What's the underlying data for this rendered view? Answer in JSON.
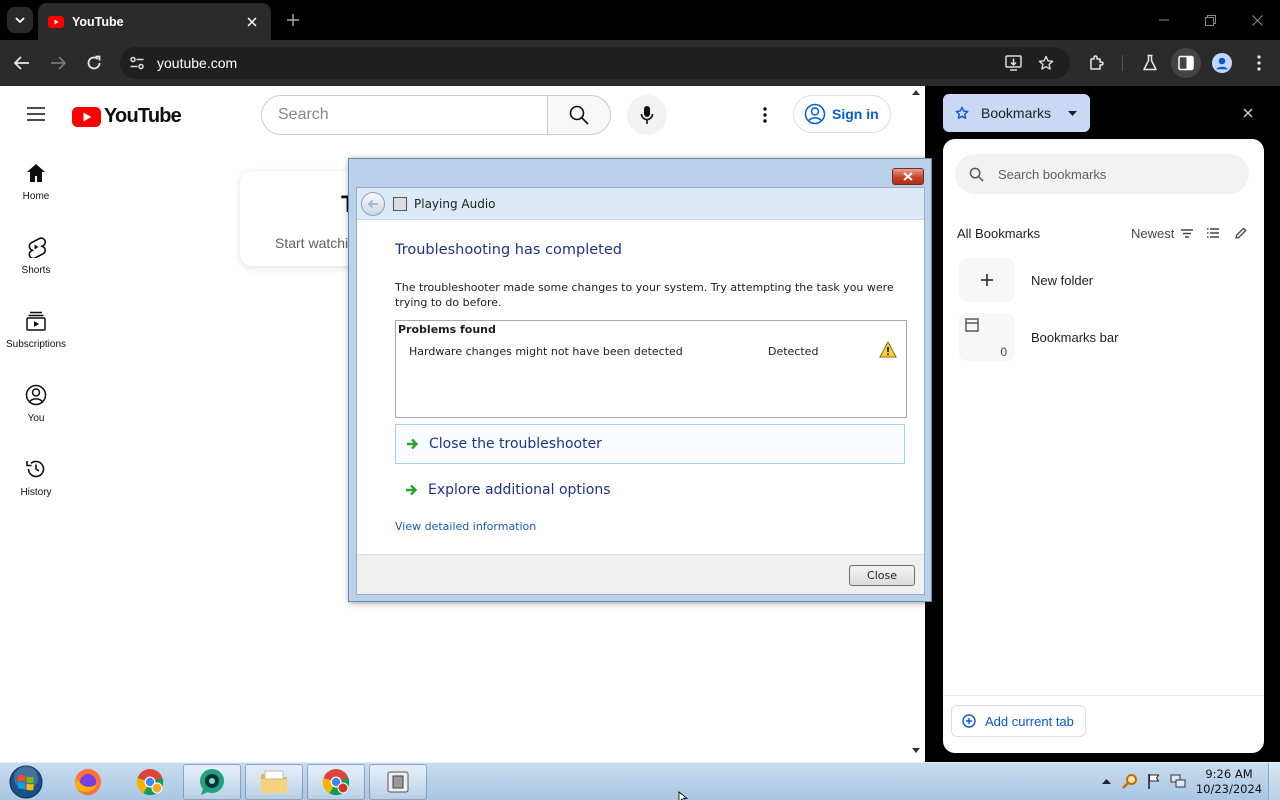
{
  "browser": {
    "tab_title": "YouTube",
    "url": "youtube.com"
  },
  "youtube": {
    "logo_text": "YouTube",
    "search_placeholder": "Search",
    "sign_in": "Sign in",
    "nav": [
      {
        "label": "Home"
      },
      {
        "label": "Shorts"
      },
      {
        "label": "Subscriptions"
      },
      {
        "label": "You"
      },
      {
        "label": "History"
      }
    ],
    "card_title": "T",
    "card_text": "Start watchi"
  },
  "bookmarks_panel": {
    "title": "Bookmarks",
    "search_placeholder": "Search bookmarks",
    "section": "All Bookmarks",
    "sort": "Newest",
    "items": [
      {
        "label": "New folder"
      },
      {
        "label": "Bookmarks bar",
        "count": "0"
      }
    ],
    "add_button": "Add current tab"
  },
  "dialog": {
    "nav_title": "Playing Audio",
    "heading": "Troubleshooting has completed",
    "description": "The troubleshooter made some changes to your system. Try attempting the task you were trying to do before.",
    "problems_header": "Problems found",
    "problems": [
      {
        "issue": "Hardware changes might not have been detected",
        "status": "Detected"
      }
    ],
    "options": [
      {
        "label": "Close the troubleshooter"
      },
      {
        "label": "Explore additional options"
      }
    ],
    "details_link": "View detailed information",
    "close_button": "Close"
  },
  "taskbar": {
    "time": "9:26 AM",
    "date": "10/23/2024"
  },
  "colors": {
    "youtube_red": "#ff0000",
    "link_blue": "#065fd4",
    "dialog_heading": "#1e3287",
    "arrow_green": "#2ea42e"
  }
}
